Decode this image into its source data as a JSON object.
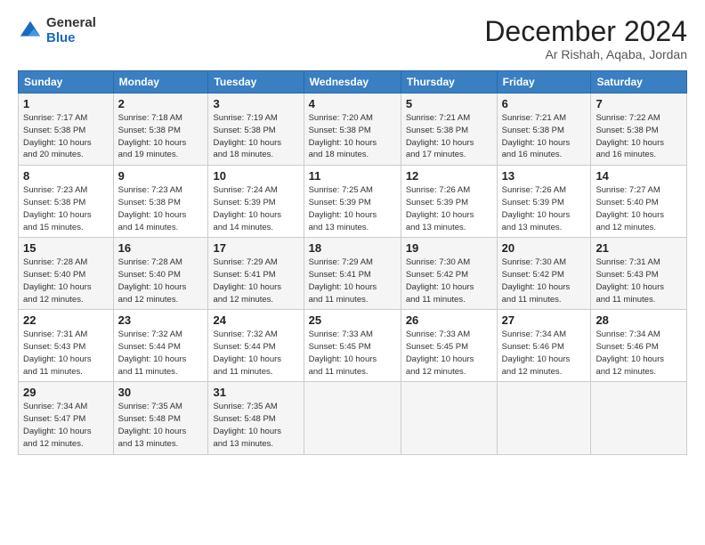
{
  "header": {
    "logo_general": "General",
    "logo_blue": "Blue",
    "month_title": "December 2024",
    "location": "Ar Rishah, Aqaba, Jordan"
  },
  "weekdays": [
    "Sunday",
    "Monday",
    "Tuesday",
    "Wednesday",
    "Thursday",
    "Friday",
    "Saturday"
  ],
  "weeks": [
    [
      {
        "day": "1",
        "info": "Sunrise: 7:17 AM\nSunset: 5:38 PM\nDaylight: 10 hours\nand 20 minutes."
      },
      {
        "day": "2",
        "info": "Sunrise: 7:18 AM\nSunset: 5:38 PM\nDaylight: 10 hours\nand 19 minutes."
      },
      {
        "day": "3",
        "info": "Sunrise: 7:19 AM\nSunset: 5:38 PM\nDaylight: 10 hours\nand 18 minutes."
      },
      {
        "day": "4",
        "info": "Sunrise: 7:20 AM\nSunset: 5:38 PM\nDaylight: 10 hours\nand 18 minutes."
      },
      {
        "day": "5",
        "info": "Sunrise: 7:21 AM\nSunset: 5:38 PM\nDaylight: 10 hours\nand 17 minutes."
      },
      {
        "day": "6",
        "info": "Sunrise: 7:21 AM\nSunset: 5:38 PM\nDaylight: 10 hours\nand 16 minutes."
      },
      {
        "day": "7",
        "info": "Sunrise: 7:22 AM\nSunset: 5:38 PM\nDaylight: 10 hours\nand 16 minutes."
      }
    ],
    [
      {
        "day": "8",
        "info": "Sunrise: 7:23 AM\nSunset: 5:38 PM\nDaylight: 10 hours\nand 15 minutes."
      },
      {
        "day": "9",
        "info": "Sunrise: 7:23 AM\nSunset: 5:38 PM\nDaylight: 10 hours\nand 14 minutes."
      },
      {
        "day": "10",
        "info": "Sunrise: 7:24 AM\nSunset: 5:39 PM\nDaylight: 10 hours\nand 14 minutes."
      },
      {
        "day": "11",
        "info": "Sunrise: 7:25 AM\nSunset: 5:39 PM\nDaylight: 10 hours\nand 13 minutes."
      },
      {
        "day": "12",
        "info": "Sunrise: 7:26 AM\nSunset: 5:39 PM\nDaylight: 10 hours\nand 13 minutes."
      },
      {
        "day": "13",
        "info": "Sunrise: 7:26 AM\nSunset: 5:39 PM\nDaylight: 10 hours\nand 13 minutes."
      },
      {
        "day": "14",
        "info": "Sunrise: 7:27 AM\nSunset: 5:40 PM\nDaylight: 10 hours\nand 12 minutes."
      }
    ],
    [
      {
        "day": "15",
        "info": "Sunrise: 7:28 AM\nSunset: 5:40 PM\nDaylight: 10 hours\nand 12 minutes."
      },
      {
        "day": "16",
        "info": "Sunrise: 7:28 AM\nSunset: 5:40 PM\nDaylight: 10 hours\nand 12 minutes."
      },
      {
        "day": "17",
        "info": "Sunrise: 7:29 AM\nSunset: 5:41 PM\nDaylight: 10 hours\nand 12 minutes."
      },
      {
        "day": "18",
        "info": "Sunrise: 7:29 AM\nSunset: 5:41 PM\nDaylight: 10 hours\nand 11 minutes."
      },
      {
        "day": "19",
        "info": "Sunrise: 7:30 AM\nSunset: 5:42 PM\nDaylight: 10 hours\nand 11 minutes."
      },
      {
        "day": "20",
        "info": "Sunrise: 7:30 AM\nSunset: 5:42 PM\nDaylight: 10 hours\nand 11 minutes."
      },
      {
        "day": "21",
        "info": "Sunrise: 7:31 AM\nSunset: 5:43 PM\nDaylight: 10 hours\nand 11 minutes."
      }
    ],
    [
      {
        "day": "22",
        "info": "Sunrise: 7:31 AM\nSunset: 5:43 PM\nDaylight: 10 hours\nand 11 minutes."
      },
      {
        "day": "23",
        "info": "Sunrise: 7:32 AM\nSunset: 5:44 PM\nDaylight: 10 hours\nand 11 minutes."
      },
      {
        "day": "24",
        "info": "Sunrise: 7:32 AM\nSunset: 5:44 PM\nDaylight: 10 hours\nand 11 minutes."
      },
      {
        "day": "25",
        "info": "Sunrise: 7:33 AM\nSunset: 5:45 PM\nDaylight: 10 hours\nand 11 minutes."
      },
      {
        "day": "26",
        "info": "Sunrise: 7:33 AM\nSunset: 5:45 PM\nDaylight: 10 hours\nand 12 minutes."
      },
      {
        "day": "27",
        "info": "Sunrise: 7:34 AM\nSunset: 5:46 PM\nDaylight: 10 hours\nand 12 minutes."
      },
      {
        "day": "28",
        "info": "Sunrise: 7:34 AM\nSunset: 5:46 PM\nDaylight: 10 hours\nand 12 minutes."
      }
    ],
    [
      {
        "day": "29",
        "info": "Sunrise: 7:34 AM\nSunset: 5:47 PM\nDaylight: 10 hours\nand 12 minutes."
      },
      {
        "day": "30",
        "info": "Sunrise: 7:35 AM\nSunset: 5:48 PM\nDaylight: 10 hours\nand 13 minutes."
      },
      {
        "day": "31",
        "info": "Sunrise: 7:35 AM\nSunset: 5:48 PM\nDaylight: 10 hours\nand 13 minutes."
      },
      {
        "day": "",
        "info": ""
      },
      {
        "day": "",
        "info": ""
      },
      {
        "day": "",
        "info": ""
      },
      {
        "day": "",
        "info": ""
      }
    ]
  ]
}
